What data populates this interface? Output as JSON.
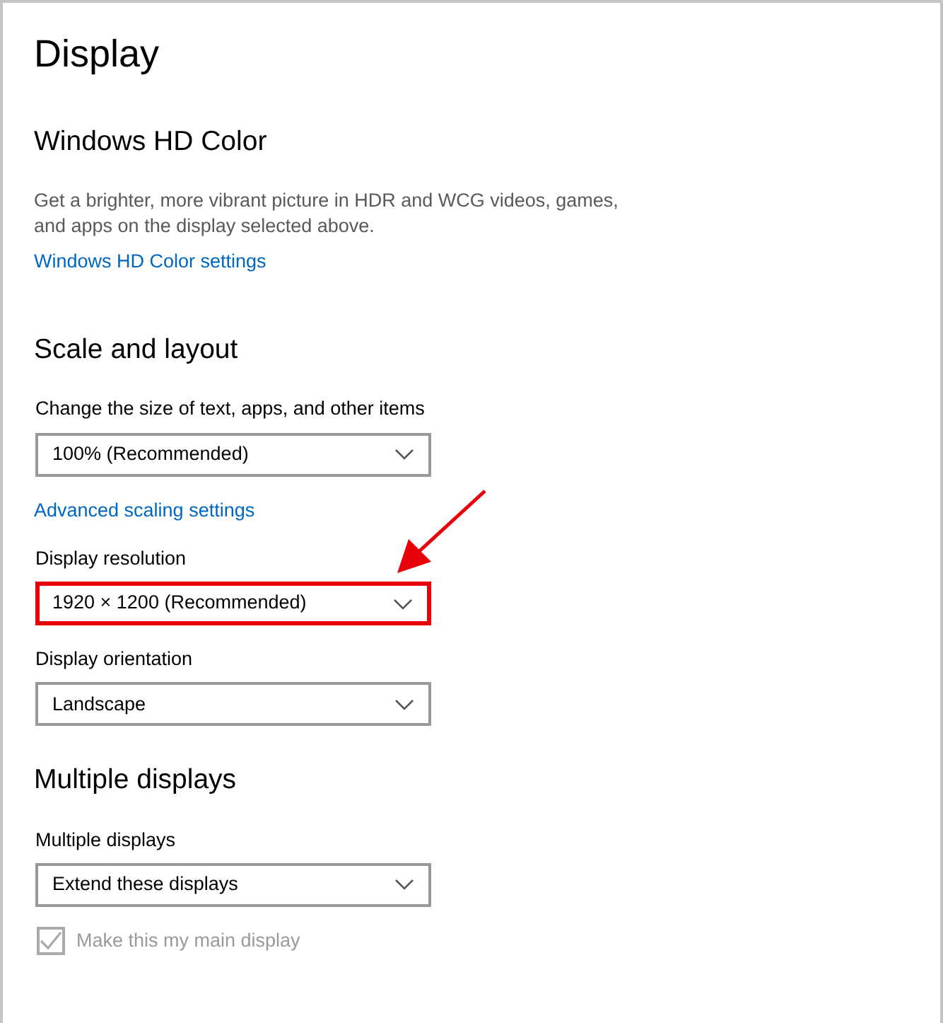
{
  "window": {
    "title": "Display"
  },
  "sections": [
    {
      "heading": "Windows HD Color",
      "items": [
        {
          "kind": "text",
          "text": "Get a brighter, more vibrant picture in HDR and WCG videos, games, and apps on the display selected above."
        },
        {
          "kind": "link",
          "text": "Windows HD Color settings"
        }
      ]
    },
    {
      "heading": "Scale and layout",
      "items": [
        {
          "kind": "dropdown",
          "label": "Change the size of text, apps, and other items",
          "value": "100% (Recommended)",
          "highlighted": false
        },
        {
          "kind": "link",
          "text": "Advanced scaling settings"
        },
        {
          "kind": "dropdown",
          "label": "Display resolution",
          "value": "1920 × 1200 (Recommended)",
          "highlighted": true
        },
        {
          "kind": "dropdown",
          "label": "Display orientation",
          "value": "Landscape",
          "highlighted": false
        }
      ]
    },
    {
      "heading": "Multiple displays",
      "items": [
        {
          "kind": "dropdown",
          "label": "Multiple displays",
          "value": "Extend these displays",
          "highlighted": false
        },
        {
          "kind": "checkbox",
          "label": "Make this my main display",
          "checked": true,
          "disabled": true
        }
      ]
    }
  ]
}
